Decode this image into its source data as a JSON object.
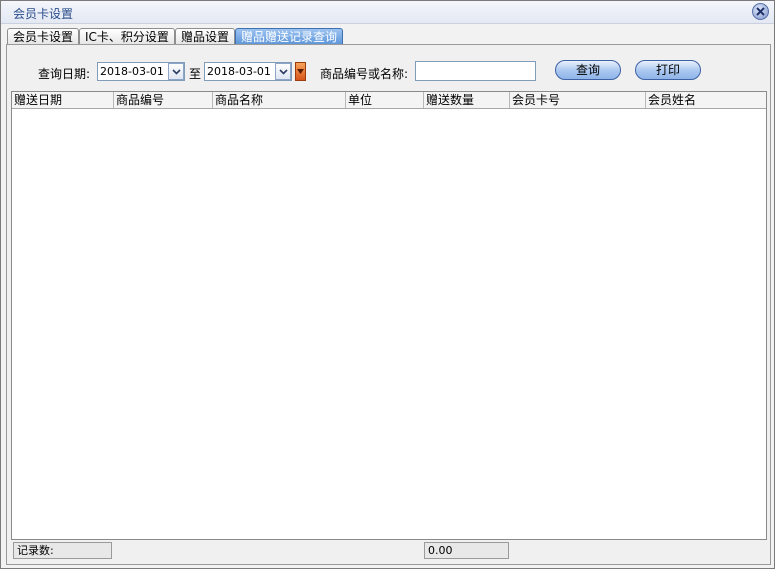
{
  "window": {
    "title": "会员卡设置"
  },
  "tabs": [
    {
      "label": "会员卡设置"
    },
    {
      "label": "IC卡、积分设置"
    },
    {
      "label": "赠品设置"
    },
    {
      "label": "赠品赠送记录查询"
    }
  ],
  "active_tab": "赠品赠送记录查询",
  "filters": {
    "date_label": "查询日期:",
    "date_from": "2018-03-01",
    "to_label": "至",
    "date_to": "2018-03-01",
    "product_label": "商品编号或名称:",
    "product_value": ""
  },
  "buttons": {
    "query": "查询",
    "print": "打印"
  },
  "table": {
    "columns": [
      "赠送日期",
      "商品编号",
      "商品名称",
      "单位",
      "赠送数量",
      "会员卡号",
      "会员姓名"
    ],
    "rows": []
  },
  "status": {
    "record_count_label": "记录数:",
    "record_count": "",
    "total": "0.00"
  },
  "colors": {
    "active_tab": "#5f97da",
    "title_text": "#2a4c8c"
  }
}
